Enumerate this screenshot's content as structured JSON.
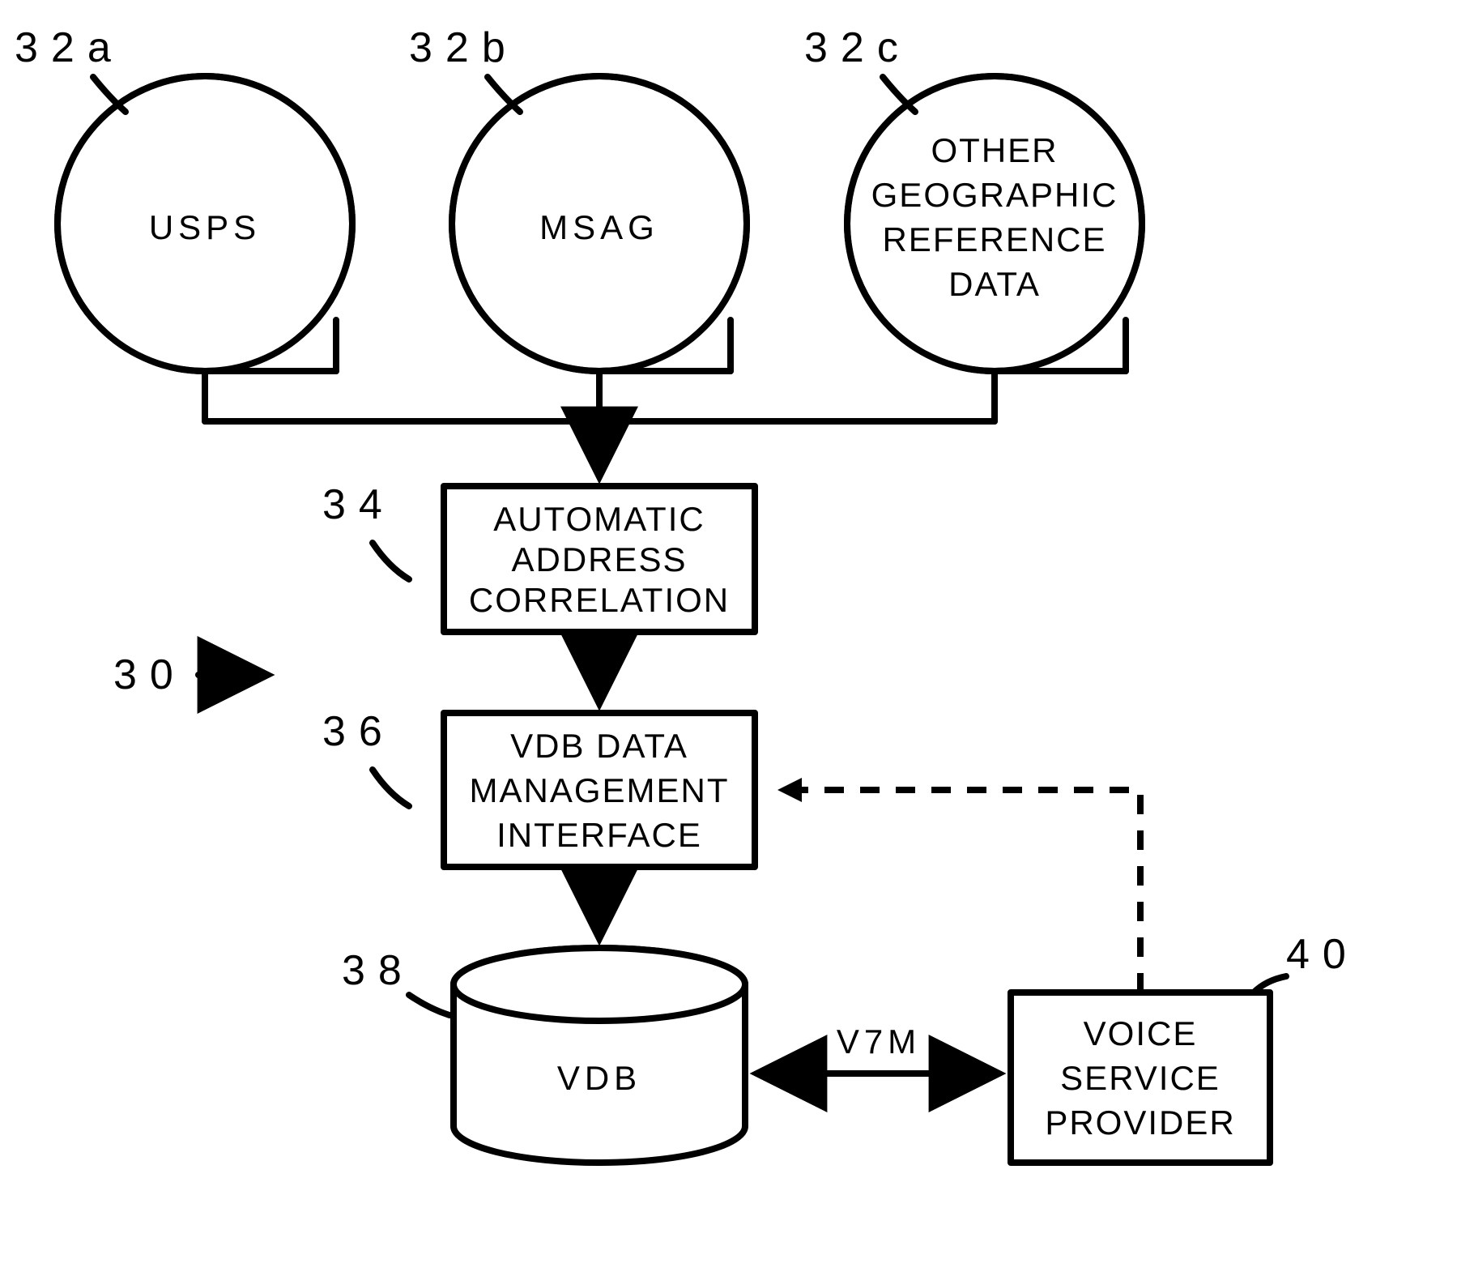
{
  "refs": {
    "r30": "30",
    "r32a": "32a",
    "r32b": "32b",
    "r32c": "32c",
    "r34": "34",
    "r36": "36",
    "r38": "38",
    "r40": "40"
  },
  "nodes": {
    "usps": "USPS",
    "msag": "MSAG",
    "other1": "OTHER",
    "other2": "GEOGRAPHIC",
    "other3": "REFERENCE",
    "other4": "DATA",
    "corr1": "AUTOMATIC",
    "corr2": "ADDRESS",
    "corr3": "CORRELATION",
    "vdbm1": "VDB DATA",
    "vdbm2": "MANAGEMENT",
    "vdbm3": "INTERFACE",
    "vdb": "VDB",
    "vsp1": "VOICE",
    "vsp2": "SERVICE",
    "vsp3": "PROVIDER"
  },
  "edges": {
    "v7m": "V7M"
  }
}
